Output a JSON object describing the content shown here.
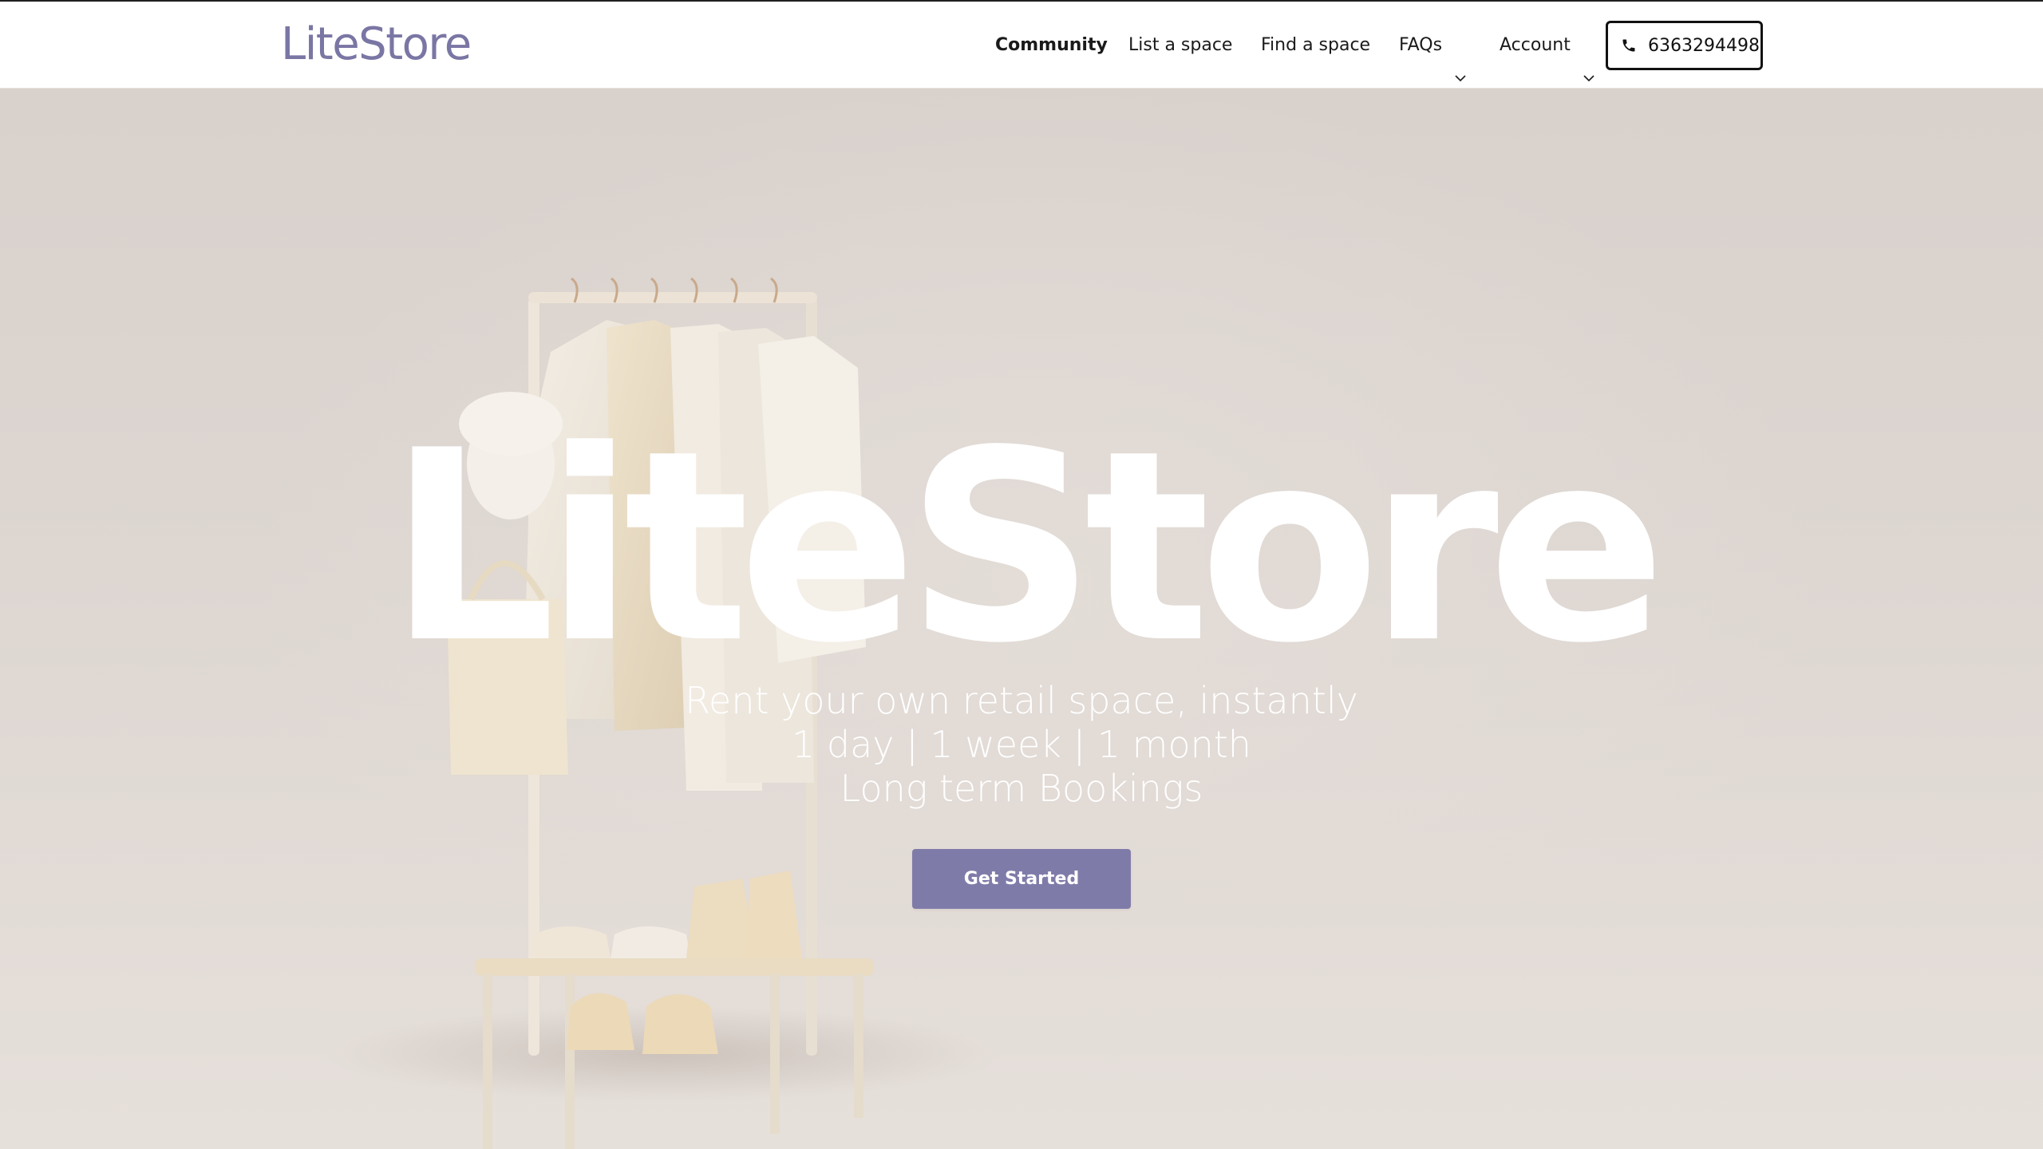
{
  "brand": {
    "logo": "LiteStore",
    "accent_color": "#7f7ba9",
    "logo_color": "#7a76a4"
  },
  "nav": {
    "community": "Community",
    "list_space": "List a space",
    "find_space": "Find a space",
    "faqs": "FAQs",
    "account": "Account",
    "phone": "6363294498",
    "phone_icon": "phone-icon",
    "dropdown_icon": "chevron-down-icon"
  },
  "hero": {
    "title": "LiteStore",
    "subtitle_lines": [
      "Rent your own retail space, instantly",
      "1 day | 1 week | 1 month",
      "Long term Bookings"
    ],
    "cta": "Get Started"
  }
}
